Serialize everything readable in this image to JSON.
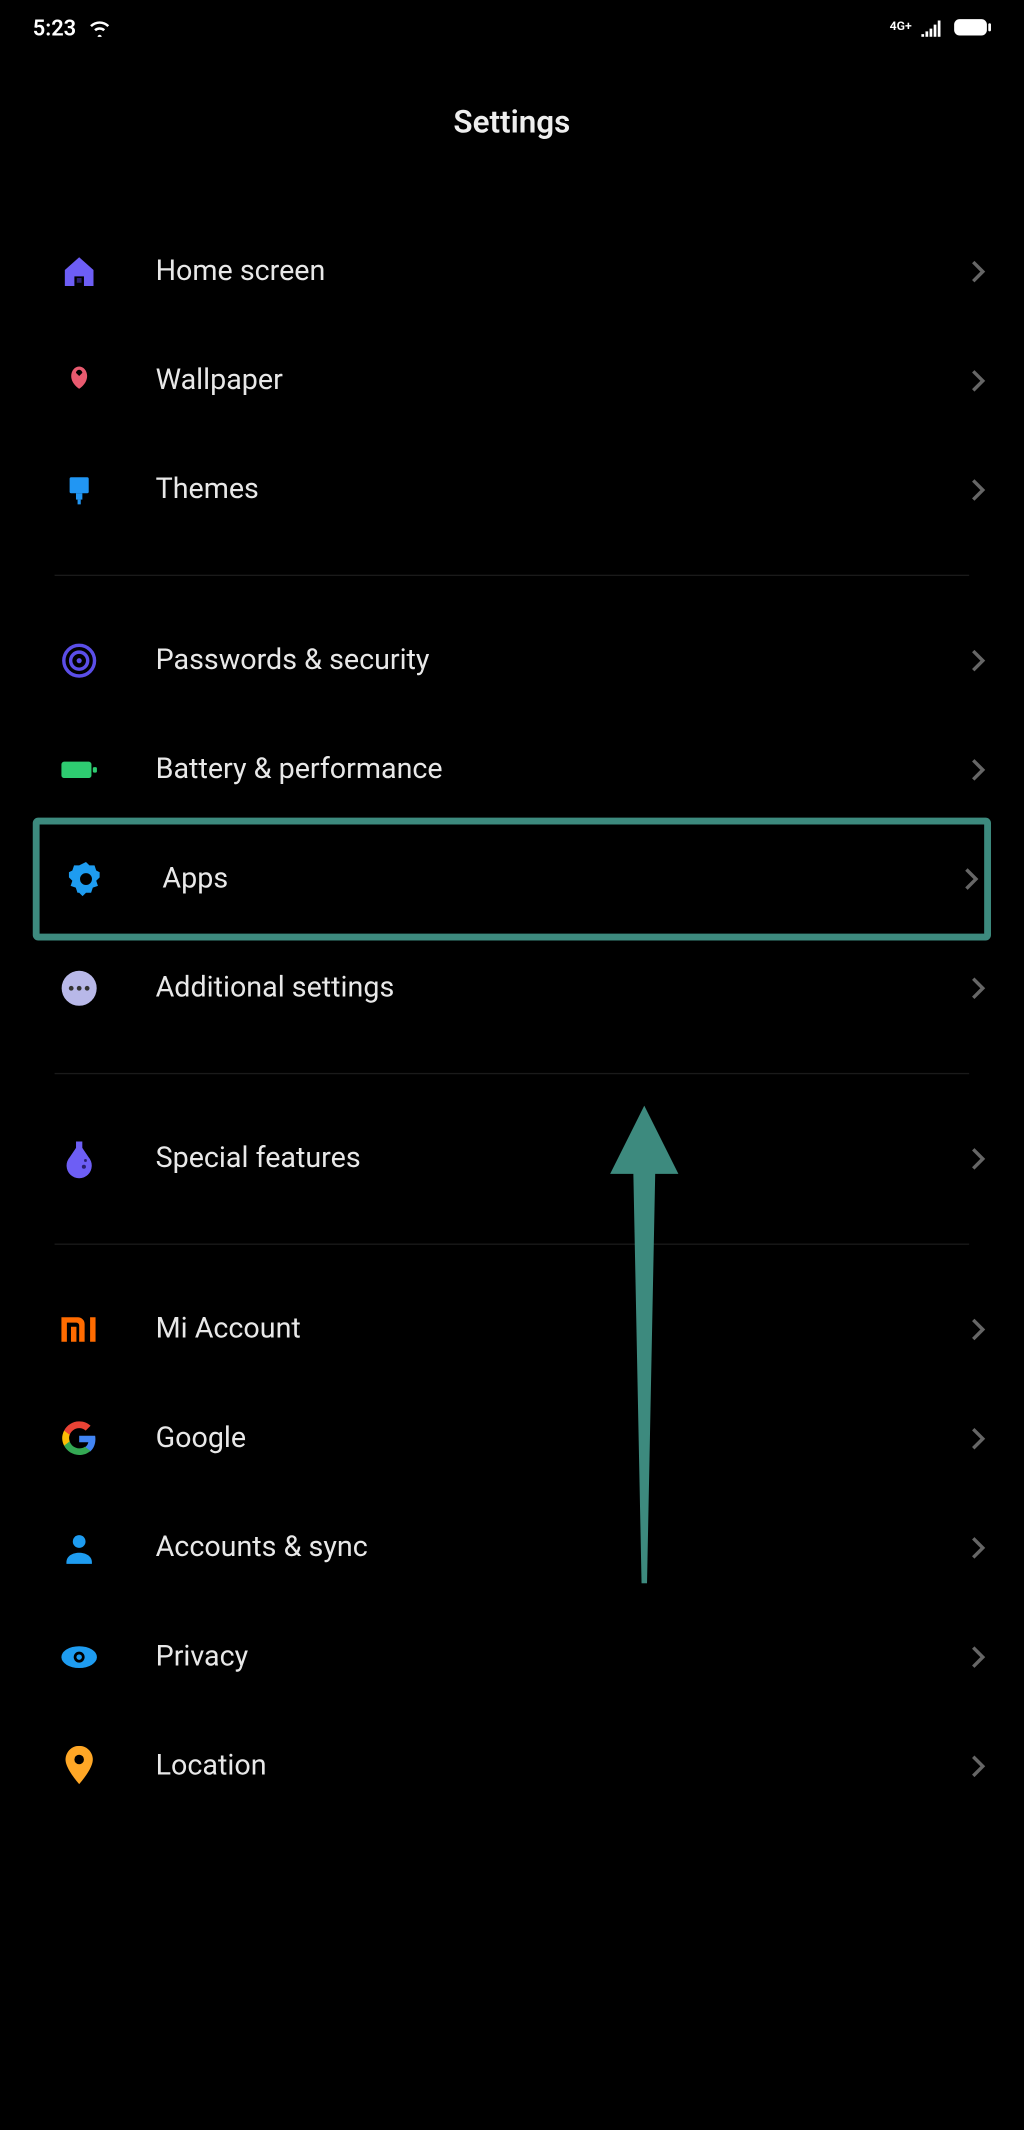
{
  "status_bar": {
    "time": "5:23",
    "network_label": "4G+"
  },
  "page_title": "Settings",
  "groups": [
    {
      "items": [
        {
          "id": "home",
          "label": "Home screen"
        },
        {
          "id": "wallpaper",
          "label": "Wallpaper"
        },
        {
          "id": "themes",
          "label": "Themes"
        }
      ]
    },
    {
      "items": [
        {
          "id": "passwords",
          "label": "Passwords & security"
        },
        {
          "id": "battery",
          "label": "Battery & performance"
        },
        {
          "id": "apps",
          "label": "Apps",
          "highlighted": true
        },
        {
          "id": "additional",
          "label": "Additional settings"
        }
      ]
    },
    {
      "items": [
        {
          "id": "special",
          "label": "Special features"
        }
      ]
    },
    {
      "items": [
        {
          "id": "mi",
          "label": "Mi Account"
        },
        {
          "id": "google",
          "label": "Google"
        },
        {
          "id": "accounts",
          "label": "Accounts & sync"
        },
        {
          "id": "privacy",
          "label": "Privacy"
        },
        {
          "id": "location",
          "label": "Location"
        }
      ]
    }
  ]
}
